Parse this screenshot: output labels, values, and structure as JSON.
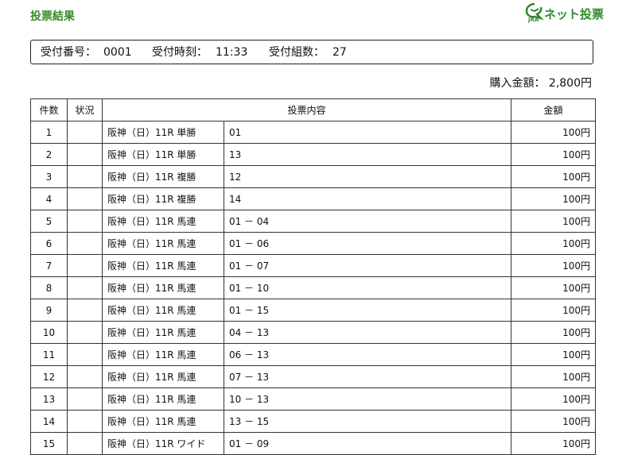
{
  "header": {
    "title": "投票結果",
    "brand_text": "ネット投票",
    "brand_small": "JRA"
  },
  "receipt": {
    "number_label": "受付番号：",
    "number": "0001",
    "time_label": "受付時刻：",
    "time": "11:33",
    "count_label": "受付組数：",
    "count": "27"
  },
  "total": {
    "label": "購入金額：",
    "value": "2,800円"
  },
  "table": {
    "headers": {
      "count": "件数",
      "status": "状況",
      "content": "投票内容",
      "amount": "金額"
    },
    "rows": [
      {
        "no": "1",
        "status": "",
        "race": "阪神（日）11R 単勝",
        "combo": "01",
        "amount": "100円"
      },
      {
        "no": "2",
        "status": "",
        "race": "阪神（日）11R 単勝",
        "combo": "13",
        "amount": "100円"
      },
      {
        "no": "3",
        "status": "",
        "race": "阪神（日）11R 複勝",
        "combo": "12",
        "amount": "100円"
      },
      {
        "no": "4",
        "status": "",
        "race": "阪神（日）11R 複勝",
        "combo": "14",
        "amount": "100円"
      },
      {
        "no": "5",
        "status": "",
        "race": "阪神（日）11R 馬連",
        "combo": "01 － 04",
        "amount": "100円"
      },
      {
        "no": "6",
        "status": "",
        "race": "阪神（日）11R 馬連",
        "combo": "01 － 06",
        "amount": "100円"
      },
      {
        "no": "7",
        "status": "",
        "race": "阪神（日）11R 馬連",
        "combo": "01 － 07",
        "amount": "100円"
      },
      {
        "no": "8",
        "status": "",
        "race": "阪神（日）11R 馬連",
        "combo": "01 － 10",
        "amount": "100円"
      },
      {
        "no": "9",
        "status": "",
        "race": "阪神（日）11R 馬連",
        "combo": "01 － 15",
        "amount": "100円"
      },
      {
        "no": "10",
        "status": "",
        "race": "阪神（日）11R 馬連",
        "combo": "04 － 13",
        "amount": "100円"
      },
      {
        "no": "11",
        "status": "",
        "race": "阪神（日）11R 馬連",
        "combo": "06 － 13",
        "amount": "100円"
      },
      {
        "no": "12",
        "status": "",
        "race": "阪神（日）11R 馬連",
        "combo": "07 － 13",
        "amount": "100円"
      },
      {
        "no": "13",
        "status": "",
        "race": "阪神（日）11R 馬連",
        "combo": "10 － 13",
        "amount": "100円"
      },
      {
        "no": "14",
        "status": "",
        "race": "阪神（日）11R 馬連",
        "combo": "13 － 15",
        "amount": "100円"
      },
      {
        "no": "15",
        "status": "",
        "race": "阪神（日）11R ワイド",
        "combo": "01 － 09",
        "amount": "100円"
      }
    ]
  },
  "colors": {
    "brand_green": "#2f8a2f",
    "title_green": "#3a8a2a"
  }
}
